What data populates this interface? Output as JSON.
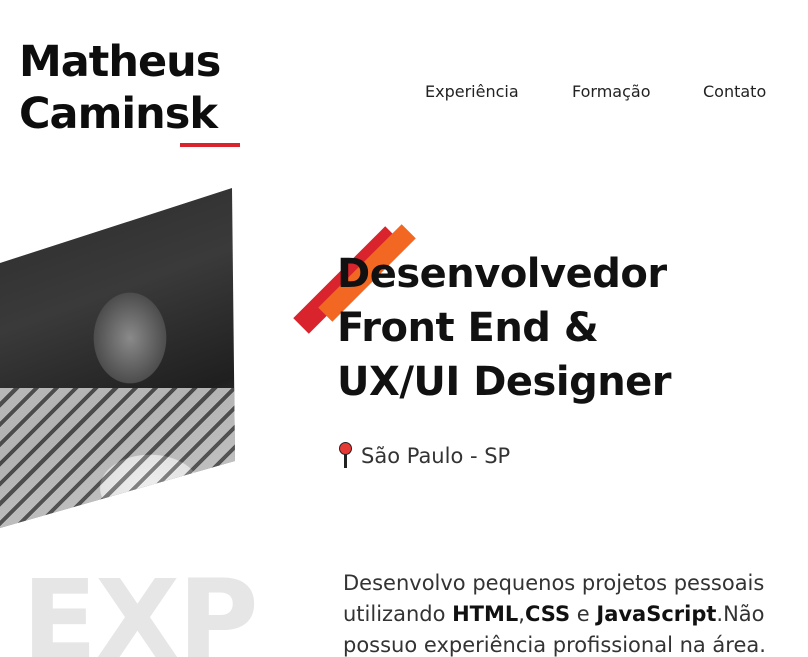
{
  "header": {
    "logo_line1": "Matheus",
    "logo_line2": "Caminsk",
    "accent_color": "#d9232d"
  },
  "nav": {
    "items": [
      {
        "label": "Experiência"
      },
      {
        "label": "Formação"
      },
      {
        "label": "Contato"
      }
    ]
  },
  "hero": {
    "headline_line1": "Desenvolvedor",
    "headline_line2": "Front End &",
    "headline_line3": "UX/UI Designer",
    "location_icon": "map-pin-icon",
    "location": "São Paulo - SP",
    "slash_colors": [
      "#d9232d",
      "#f26722"
    ],
    "photo_alt": "profile-photo"
  },
  "experience": {
    "watermark": "EXP",
    "desc_part1": "Desenvolvo pequenos projetos pessoais",
    "desc_part2": "utilizando ",
    "tech1": "HTML",
    "sep1": ",",
    "tech2": "CSS",
    "sep2": " e ",
    "tech3": "JavaScript",
    "desc_part3": ".Não",
    "desc_part4": "possuo experiência profissional na área."
  }
}
